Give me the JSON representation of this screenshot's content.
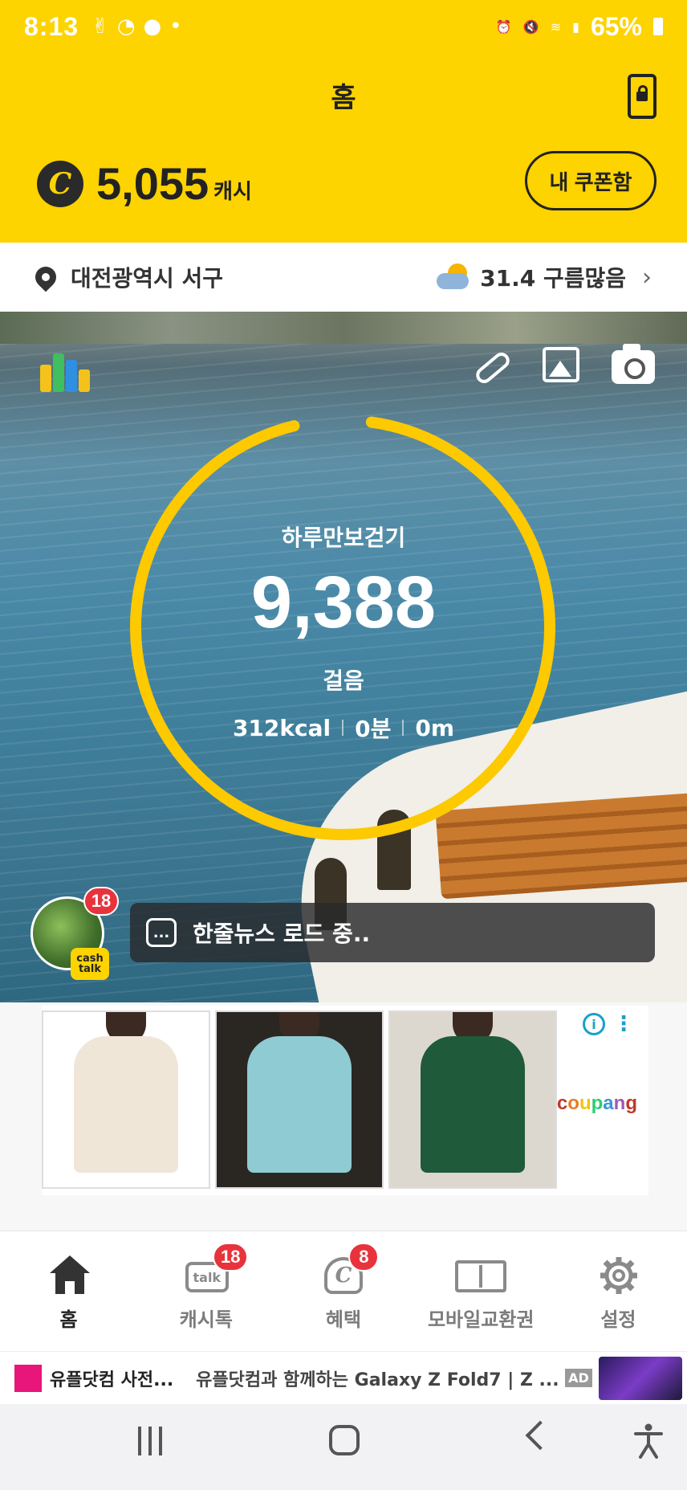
{
  "status_bar": {
    "time": "8:13",
    "battery": "65%"
  },
  "header": {
    "title": "홈",
    "cash_amount": "5,055",
    "cash_unit": "캐시",
    "coupon_button": "내 쿠폰함",
    "cash_icon": "C"
  },
  "location": {
    "place": "대전광역시 서구",
    "weather": "31.4 구름많음"
  },
  "steps": {
    "label": "하루만보걷기",
    "count": "9,388",
    "unit": "걸음",
    "kcal": "312kcal",
    "minutes": "0분",
    "distance": "0m",
    "progress": 0.94
  },
  "chat": {
    "badge": "18",
    "tag_line1": "cash",
    "tag_line2": "talk",
    "news": "한줄뉴스 로드 중..",
    "dots": "..."
  },
  "ad": {
    "brand": "coupang",
    "brand_colors": [
      "#c0392b",
      "#e67e22",
      "#f1c40f",
      "#2ecc71",
      "#3498db",
      "#9b59b6",
      "#c0392b"
    ],
    "shirt_colors": [
      "#efe6d8",
      "#8fcbd3",
      "#1f5a3b"
    ]
  },
  "nav": {
    "items": [
      {
        "label": "홈",
        "icon": "home-icon",
        "badge": ""
      },
      {
        "label": "캐시톡",
        "icon": "talk-icon",
        "badge": "18"
      },
      {
        "label": "혜택",
        "icon": "coin-icon",
        "badge": "8"
      },
      {
        "label": "모바일교환권",
        "icon": "voucher-icon",
        "badge": ""
      },
      {
        "label": "설정",
        "icon": "gear-icon",
        "badge": ""
      }
    ]
  },
  "banner": {
    "title": "유플닷컴 사전...",
    "desc": "유플닷컴과 함께하는 Galaxy Z Fold7 | Z ...",
    "ad_label": "AD"
  },
  "colors": {
    "brand_yellow": "#fdd300",
    "badge_red": "#e8333c"
  }
}
